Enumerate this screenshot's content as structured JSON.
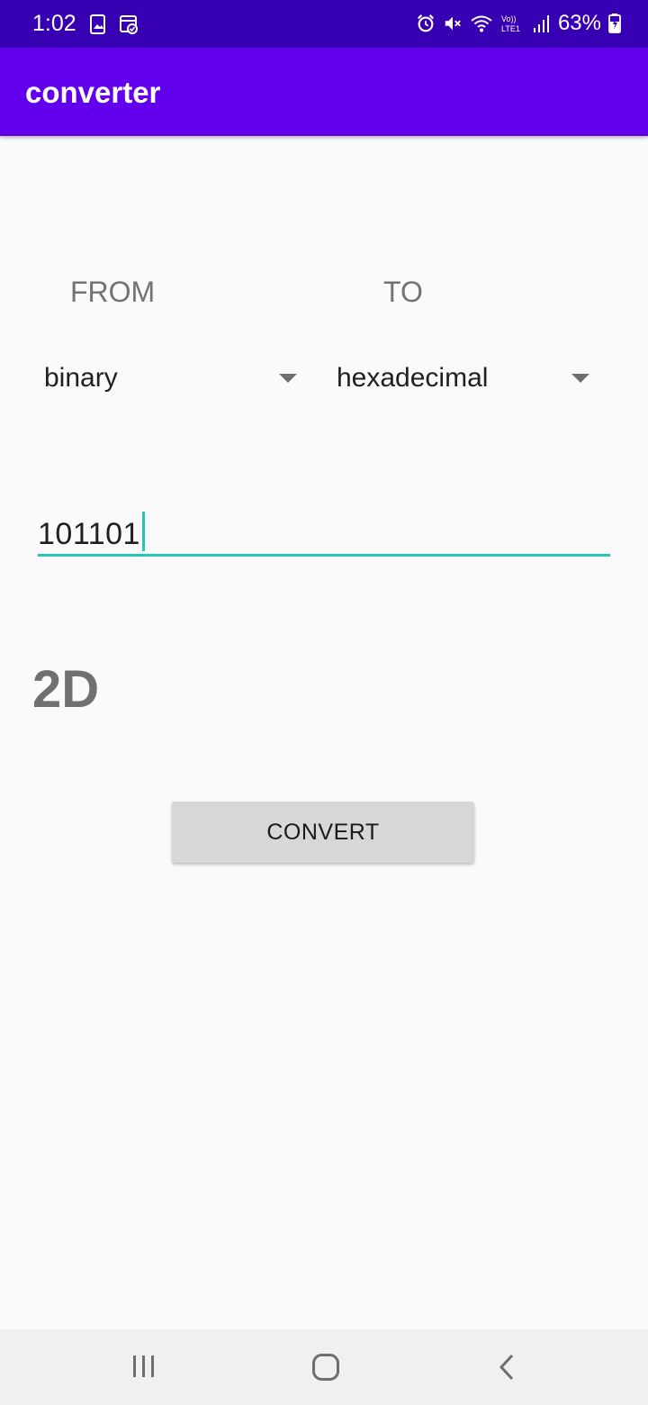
{
  "status_bar": {
    "time": "1:02",
    "battery_percent": "63%",
    "icons": [
      "image-notification-icon",
      "calendar-check-icon",
      "alarm-icon",
      "mute-icon",
      "wifi-icon",
      "volte-icon",
      "signal-icon",
      "battery-charging-icon"
    ]
  },
  "app_bar": {
    "title": "converter"
  },
  "labels": {
    "from": "FROM",
    "to": "TO"
  },
  "spinners": {
    "from_value": "binary",
    "to_value": "hexadecimal"
  },
  "input": {
    "value": "101101"
  },
  "result": {
    "value": "2D"
  },
  "button": {
    "convert_label": "CONVERT"
  },
  "nav_bar": {
    "icons": [
      "recent-apps-icon",
      "home-icon",
      "back-icon"
    ]
  },
  "colors": {
    "status_bar": "#3700b3",
    "app_bar": "#6200ee",
    "accent": "#26c6b7",
    "background": "#fafafa",
    "button": "#d6d7d7"
  }
}
